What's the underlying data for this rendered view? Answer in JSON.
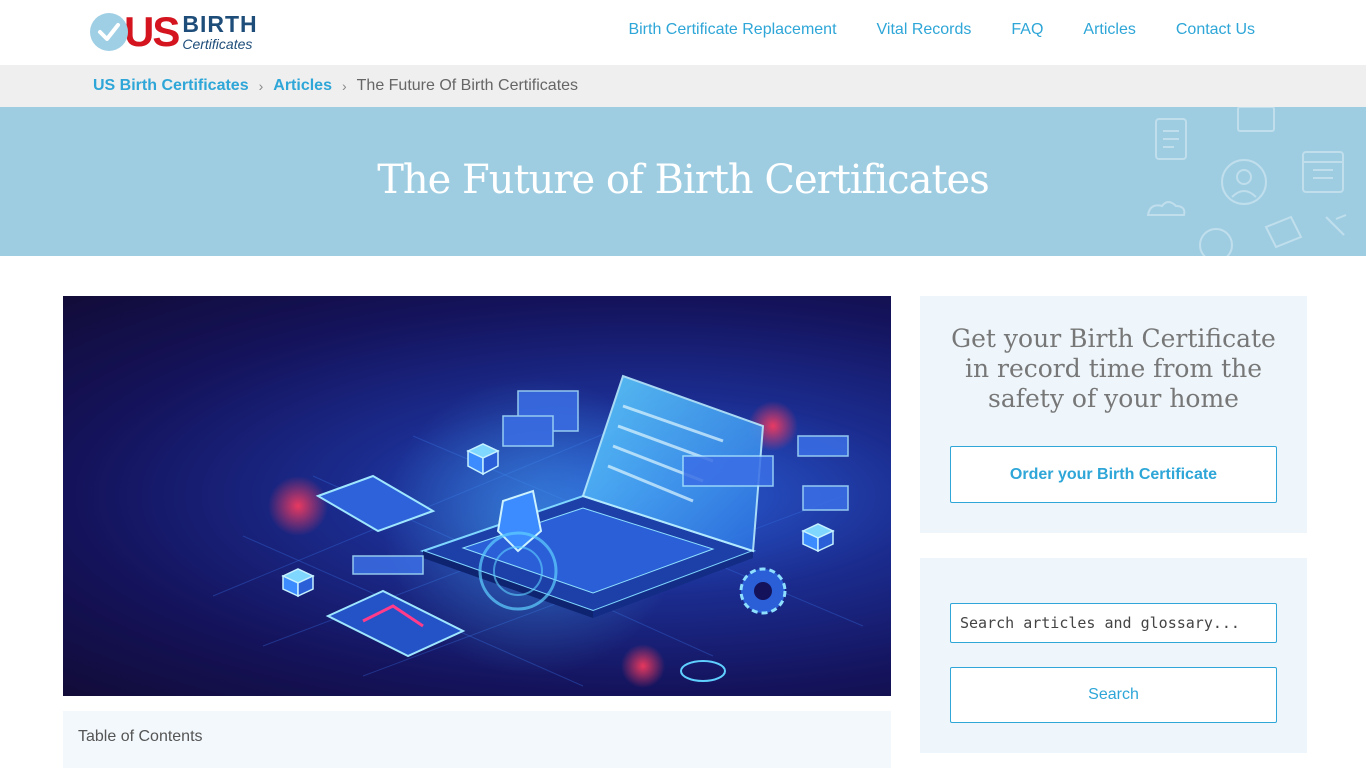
{
  "header": {
    "logo": {
      "us": "US",
      "birth": "BIRTH",
      "certificates": "Certificates"
    },
    "nav": [
      {
        "label": "Birth Certificate Replacement"
      },
      {
        "label": "Vital Records"
      },
      {
        "label": "FAQ"
      },
      {
        "label": "Articles"
      },
      {
        "label": "Contact Us"
      }
    ]
  },
  "breadcrumb": {
    "home": "US Birth Certificates",
    "section": "Articles",
    "current": "The Future Of Birth Certificates",
    "separator": "›"
  },
  "hero": {
    "title": "The Future of Birth Certificates"
  },
  "main": {
    "toc_label": "Table of Contents"
  },
  "sidebar": {
    "cta_heading": "Get your Birth Certificate in record time from the safety of your home",
    "cta_button": "Order your Birth Certificate",
    "search_placeholder": "Search articles and glossary...",
    "search_button": "Search"
  },
  "colors": {
    "accent": "#2ea6d7",
    "hero_bg": "#9ecde2",
    "logo_red": "#d4151f",
    "logo_navy": "#1e4d7a"
  }
}
